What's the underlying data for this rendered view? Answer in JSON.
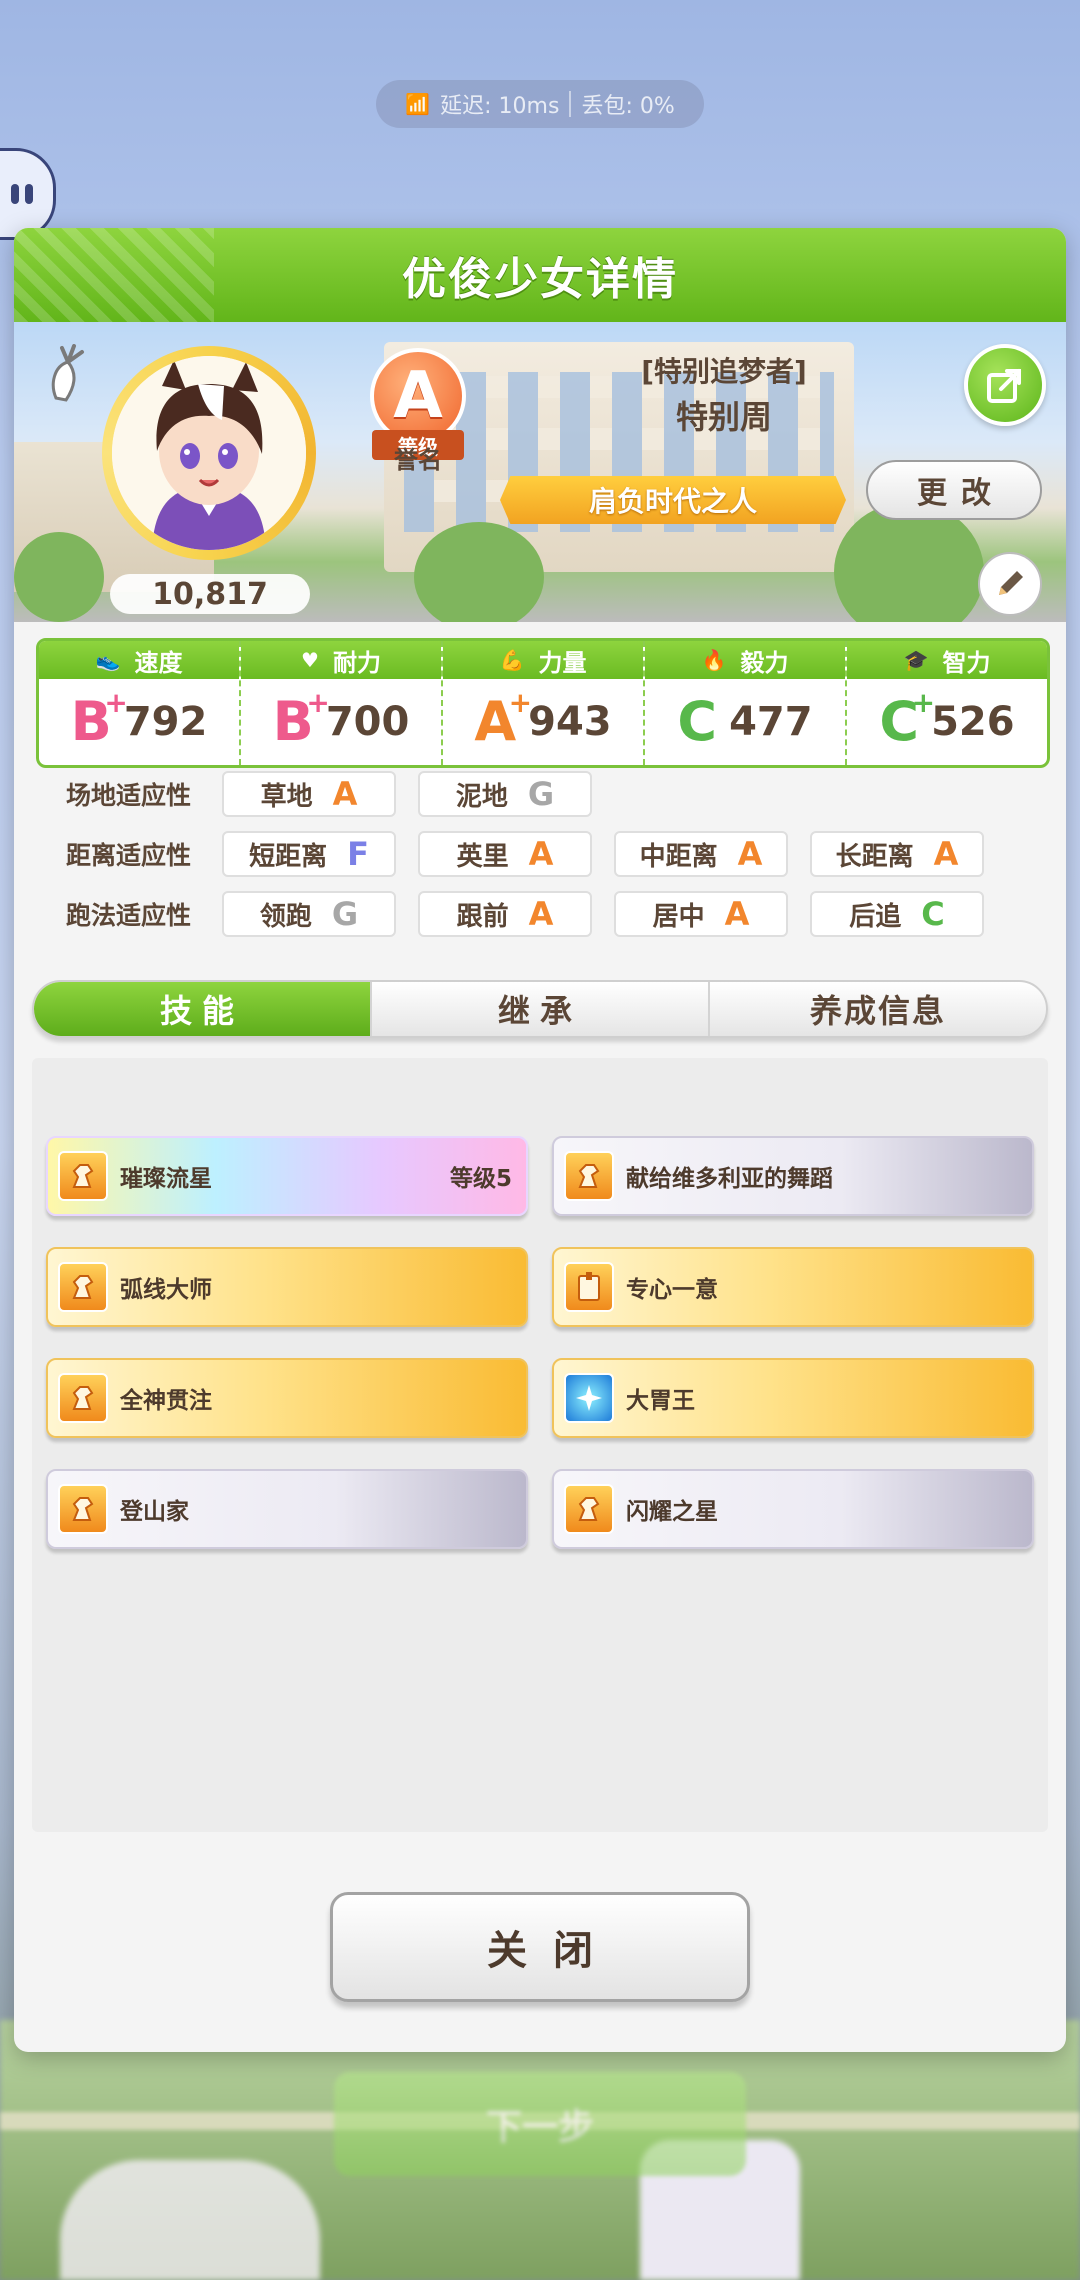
{
  "network": {
    "latency": "延迟: 10ms",
    "packet_loss": "丢包: 0%"
  },
  "dialog": {
    "title": "优俊少女详情"
  },
  "profile": {
    "fans": "10,817",
    "rank_grade": "A",
    "rank_ribbon": "等级",
    "rank_sub": "誉名",
    "epithet": "[特别追梦者]",
    "name": "特别周",
    "title": "肩负时代之人",
    "change_label": "更改"
  },
  "stats": [
    {
      "label": "速度",
      "grade": "B",
      "plus": "+",
      "value": "792",
      "grade_color": "#ee5a8c"
    },
    {
      "label": "耐力",
      "grade": "B",
      "plus": "+",
      "value": "700",
      "grade_color": "#ee5a8c"
    },
    {
      "label": "力量",
      "grade": "A",
      "plus": "+",
      "value": "943",
      "grade_color": "#f2862d"
    },
    {
      "label": "毅力",
      "grade": "C",
      "plus": "",
      "value": "477",
      "grade_color": "#58b84b"
    },
    {
      "label": "智力",
      "grade": "C",
      "plus": "+",
      "value": "526",
      "grade_color": "#58b84b"
    }
  ],
  "aptitude": {
    "track": {
      "label": "场地适应性",
      "items": [
        {
          "name": "草地",
          "grade": "A"
        },
        {
          "name": "泥地",
          "grade": "G"
        }
      ]
    },
    "distance": {
      "label": "距离适应性",
      "items": [
        {
          "name": "短距离",
          "grade": "F"
        },
        {
          "name": "英里",
          "grade": "A"
        },
        {
          "name": "中距离",
          "grade": "A"
        },
        {
          "name": "长距离",
          "grade": "A"
        }
      ]
    },
    "style": {
      "label": "跑法适应性",
      "items": [
        {
          "name": "领跑",
          "grade": "G"
        },
        {
          "name": "跟前",
          "grade": "A"
        },
        {
          "name": "居中",
          "grade": "A"
        },
        {
          "name": "后追",
          "grade": "C"
        }
      ]
    }
  },
  "tabs": [
    {
      "label": "技能",
      "active": true
    },
    {
      "label": "继承",
      "active": false
    },
    {
      "label": "养成信息",
      "active": false
    }
  ],
  "skills": [
    {
      "name": "璀璨流星",
      "level": "等级5",
      "style": "rainbow",
      "icon": "running-horse-icon"
    },
    {
      "name": "献给维多利亚的舞蹈",
      "level": "",
      "style": "white",
      "icon": "running-horse-icon"
    },
    {
      "name": "弧线大师",
      "level": "",
      "style": "gold",
      "icon": "running-horse-icon"
    },
    {
      "name": "专心一意",
      "level": "",
      "style": "gold",
      "icon": "focus-icon"
    },
    {
      "name": "全神贯注",
      "level": "",
      "style": "gold",
      "icon": "running-horse-icon"
    },
    {
      "name": "大胃王",
      "level": "",
      "style": "gold",
      "icon": "sparkle-icon"
    },
    {
      "name": "登山家",
      "level": "",
      "style": "white",
      "icon": "running-horse-icon"
    },
    {
      "name": "闪耀之星",
      "level": "",
      "style": "white",
      "icon": "running-horse-icon"
    }
  ],
  "close_label": "关闭",
  "next_label": "下一步"
}
